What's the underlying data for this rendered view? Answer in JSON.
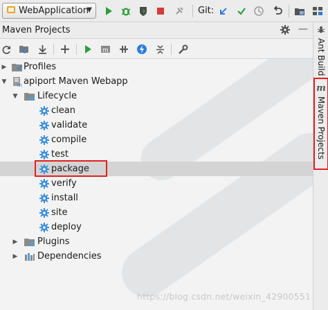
{
  "toolbar": {
    "run_config": "WebApplication",
    "git_label": "Git:"
  },
  "panel": {
    "title": "Maven Projects"
  },
  "tree": {
    "profiles": "Profiles",
    "project": "apiport Maven Webapp",
    "lifecycle": "Lifecycle",
    "goals": [
      "clean",
      "validate",
      "compile",
      "test",
      "package",
      "verify",
      "install",
      "site",
      "deploy"
    ],
    "selected_goal": "package",
    "plugins": "Plugins",
    "dependencies": "Dependencies"
  },
  "side_tabs": {
    "ant_build": "Ant Build",
    "maven_projects": "Maven Projects"
  },
  "watermark": "https://blog.csdn.net/weixin_42900551",
  "colors": {
    "run_green": "#2e9e3e",
    "stop_red": "#d63a3a",
    "git_blue": "#2f7ed8",
    "highlight_red": "#e02020",
    "selection_gray": "#d4d4d4"
  }
}
